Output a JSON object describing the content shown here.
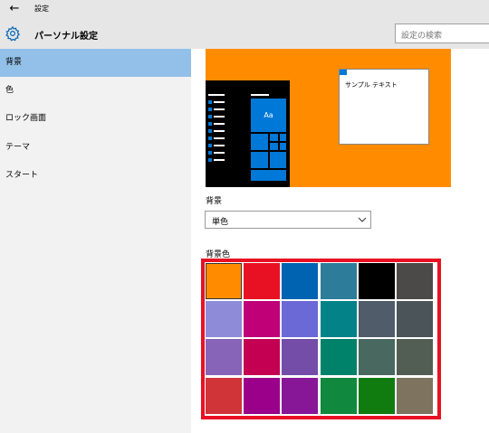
{
  "window": {
    "back_glyph": "←",
    "title": "設定"
  },
  "header": {
    "title": "パーソナル設定",
    "search_placeholder": "設定の検索"
  },
  "sidebar": {
    "items": [
      {
        "label": "背景",
        "active": true
      },
      {
        "label": "色",
        "active": false
      },
      {
        "label": "ロック画面",
        "active": false
      },
      {
        "label": "テーマ",
        "active": false
      },
      {
        "label": "スタート",
        "active": false
      }
    ]
  },
  "preview": {
    "tile_label": "Aa",
    "sample_text": "サンプル テキスト",
    "background_color": "#ff8c00"
  },
  "background": {
    "label": "背景",
    "selected_value": "単色"
  },
  "background_color": {
    "label": "背景色",
    "selected_index": 0,
    "swatches": [
      "#ff8c00",
      "#e81123",
      "#0063b1",
      "#2d7d9a",
      "#000000",
      "#4c4a48",
      "#8e8cd8",
      "#bf0077",
      "#6b69d6",
      "#038387",
      "#515c6b",
      "#4a5459",
      "#8764b8",
      "#c30052",
      "#744da9",
      "#00826a",
      "#486860",
      "#525e54",
      "#d13438",
      "#9a0089",
      "#881798",
      "#10893e",
      "#107c10",
      "#7e735f"
    ]
  },
  "icons": {
    "settings": "gear-icon",
    "dropdown": "chevron-down-icon",
    "back": "arrow-left-icon"
  }
}
